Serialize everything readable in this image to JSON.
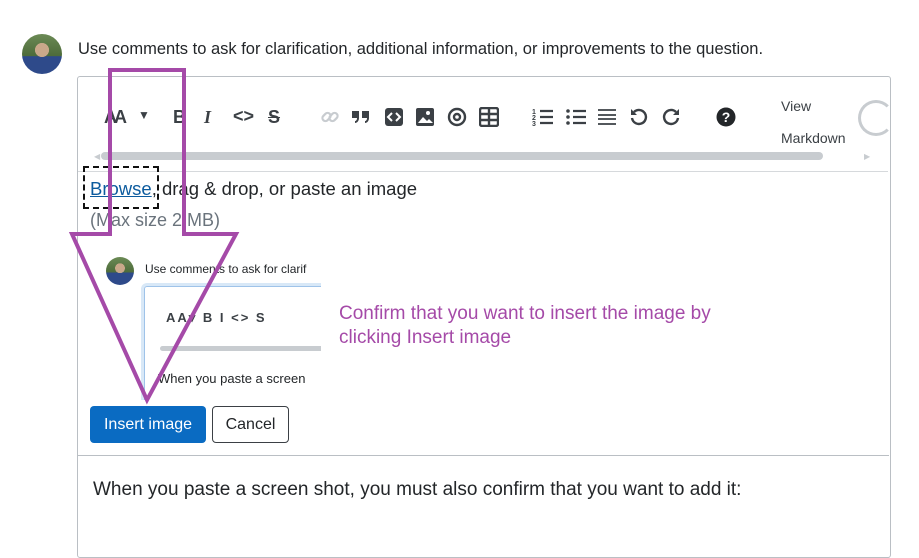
{
  "prompt_text": "Use comments to ask for clarification, additional information, or improvements to the question.",
  "toolbar": {
    "heading_label": "AA",
    "bold_label": "B",
    "italic_label": "I",
    "code_label": "<>",
    "strike_label": "S",
    "view_label": "View",
    "markdown_label": "Markdown"
  },
  "upload": {
    "browse_label": "Browse",
    "rest_text": ", drag & drop, or paste an image",
    "max_size": "(Max size 2 MB)"
  },
  "preview": {
    "text": "Use comments to ask for clarif",
    "tools": "AA▾ B I <> S",
    "body": "When you paste a screen"
  },
  "callout": {
    "line1": "Confirm that you want to insert the image by",
    "line2": "clicking Insert image"
  },
  "buttons": {
    "insert_label": "Insert image",
    "cancel_label": "Cancel"
  },
  "body_text": "When you paste a screen shot, you must also confirm that you want to add it:",
  "colors": {
    "annotation_purple": "#a54aa8",
    "primary_button": "#0a6bc2",
    "link": "#0c5b9e"
  }
}
